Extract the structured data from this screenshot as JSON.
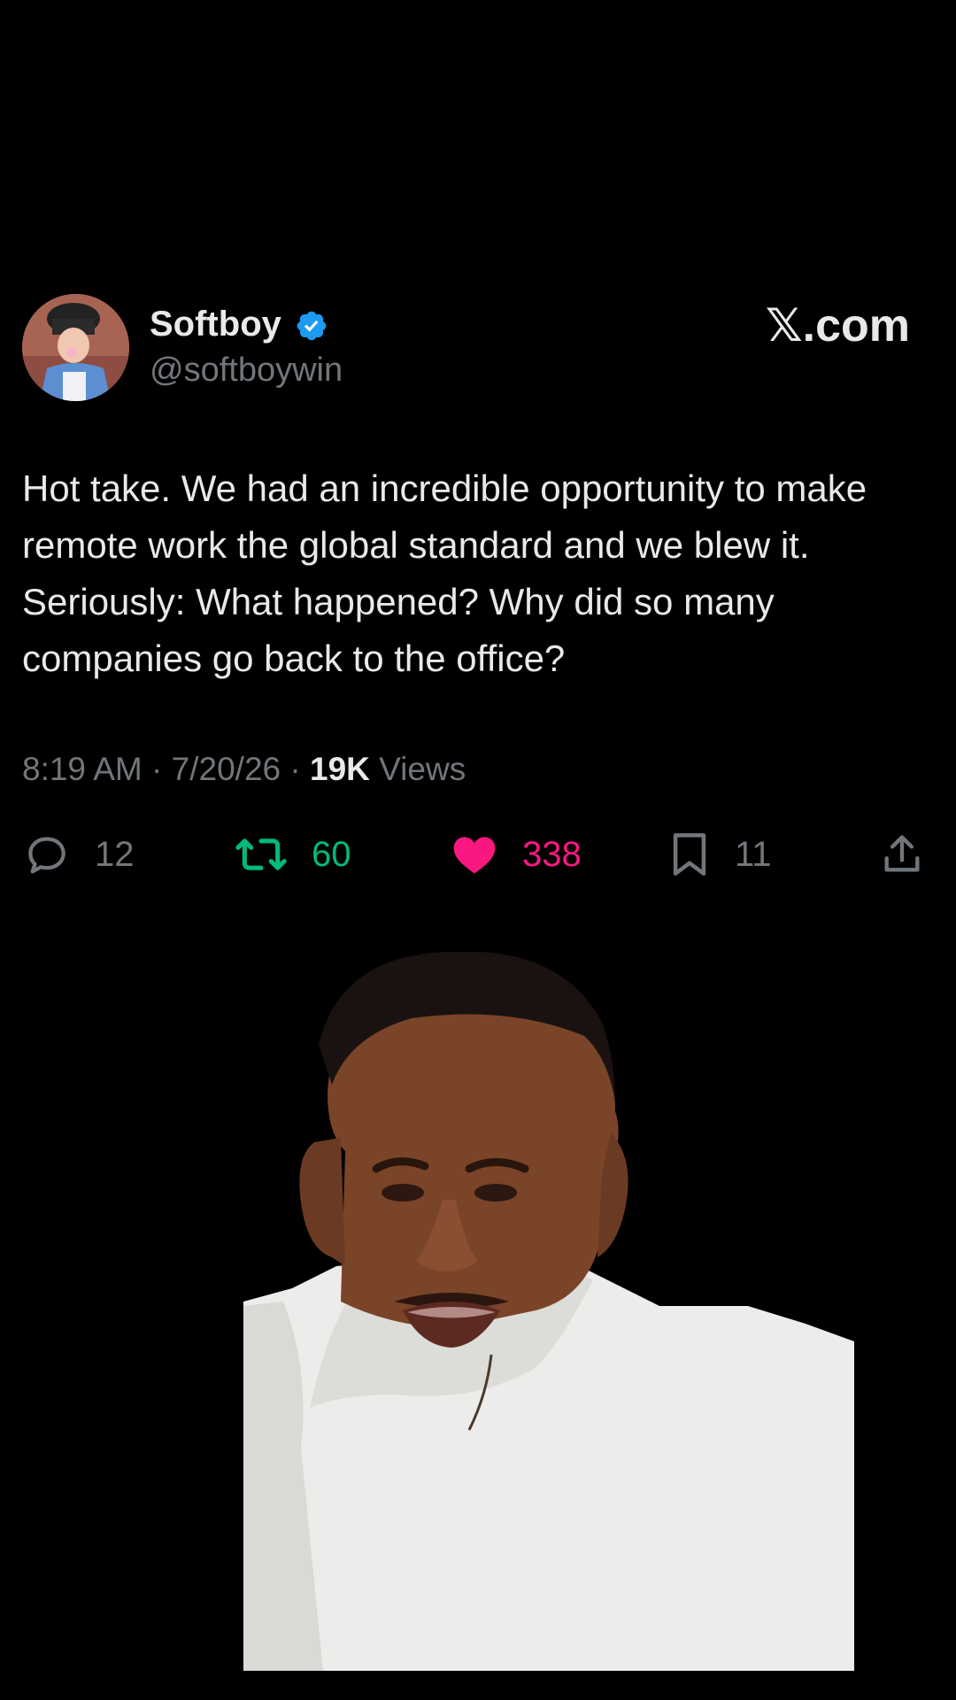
{
  "author": {
    "display_name": "Softboy",
    "handle": "@softboywin",
    "verified": true
  },
  "brand": {
    "label": "𝕏.com"
  },
  "tweet": {
    "text": "Hot take. We had an incredible opportunity to make remote work the global standard and we blew it. Seriously: What happened? Why did so many companies go back to the office?",
    "time": "8:19 AM",
    "date": "7/20/26",
    "separator": "·",
    "views_count": "19K",
    "views_label": "Views"
  },
  "actions": {
    "reply_count": "12",
    "retweet_count": "60",
    "like_count": "338",
    "bookmark_count": "11"
  },
  "icons": [
    "reply-icon",
    "retweet-icon",
    "like-icon",
    "bookmark-icon",
    "share-icon",
    "verified-badge-icon"
  ],
  "colors": {
    "background": "#000000",
    "text": "#e7e9ea",
    "muted": "#71767b",
    "retweet": "#00ba7c",
    "like": "#f91880",
    "verified": "#1d9bf0"
  }
}
